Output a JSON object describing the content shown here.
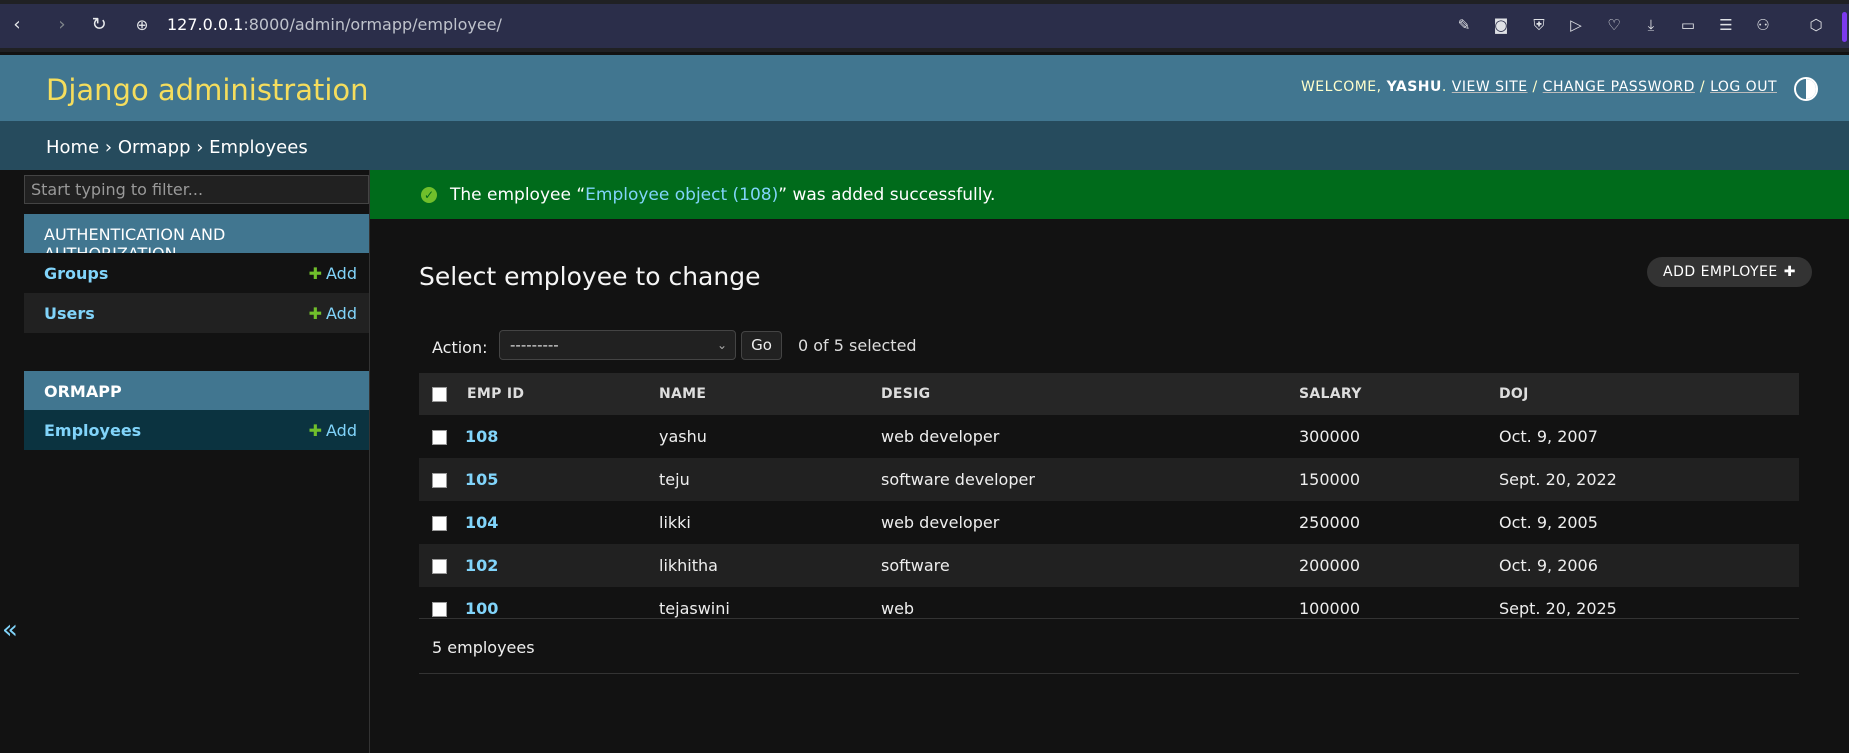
{
  "browser": {
    "url_host": "127.0.0.1",
    "url_path": ":8000/admin/ormapp/employee/"
  },
  "header": {
    "brand": "Django administration",
    "welcome": "WELCOME,",
    "username": "YASHU",
    "view_site": "VIEW SITE",
    "change_password": "CHANGE PASSWORD",
    "log_out": "LOG OUT",
    "sep": "/"
  },
  "breadcrumbs": {
    "home": "Home",
    "app": "Ormapp",
    "current": "Employees",
    "sep": "›"
  },
  "sidebar": {
    "filter_placeholder": "Start typing to filter...",
    "modules": [
      {
        "caption": "AUTHENTICATION AND AUTHORIZATION",
        "rows": [
          {
            "label": "Groups",
            "add": "Add"
          },
          {
            "label": "Users",
            "add": "Add"
          }
        ]
      },
      {
        "caption": "ORMAPP",
        "rows": [
          {
            "label": "Employees",
            "add": "Add"
          }
        ]
      }
    ],
    "collapse": "«"
  },
  "message": {
    "prefix": "The employee “",
    "object": "Employee object (108)",
    "suffix": "” was added successfully."
  },
  "main": {
    "title": "Select employee to change",
    "add_button": "ADD EMPLOYEE",
    "action_label": "Action:",
    "action_value": "---------",
    "go": "Go",
    "selected_count": "0 of 5 selected",
    "columns": [
      "EMP ID",
      "NAME",
      "DESIG",
      "SALARY",
      "DOJ"
    ],
    "rows": [
      {
        "id": "108",
        "name": "yashu",
        "desig": "web developer",
        "salary": "300000",
        "doj": "Oct. 9, 2007"
      },
      {
        "id": "105",
        "name": "teju",
        "desig": "software developer",
        "salary": "150000",
        "doj": "Sept. 20, 2022"
      },
      {
        "id": "104",
        "name": "likki",
        "desig": "web developer",
        "salary": "250000",
        "doj": "Oct. 9, 2005"
      },
      {
        "id": "102",
        "name": "likhitha",
        "desig": "software",
        "salary": "200000",
        "doj": "Oct. 9, 2006"
      },
      {
        "id": "100",
        "name": "tejaswini",
        "desig": "web",
        "salary": "100000",
        "doj": "Sept. 20, 2025"
      }
    ],
    "footer": "5 employees"
  }
}
